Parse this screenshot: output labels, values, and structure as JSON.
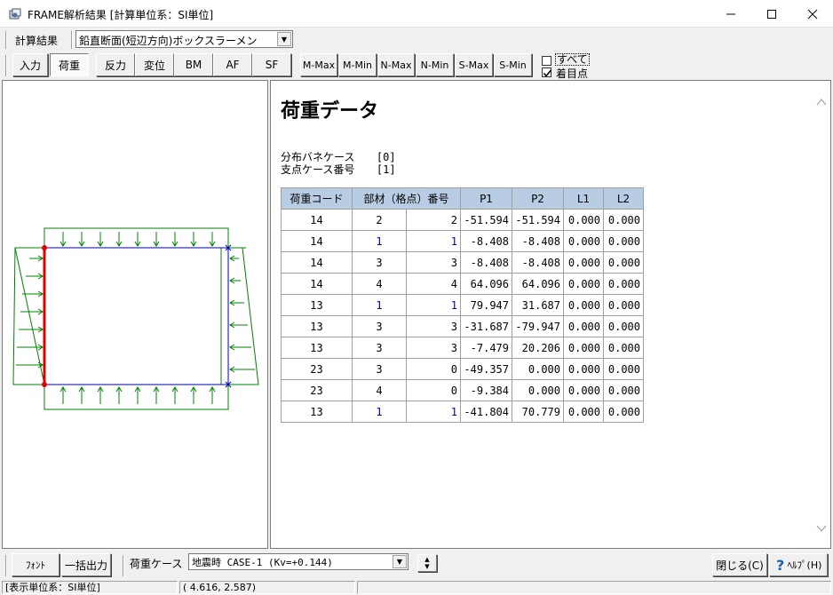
{
  "window": {
    "title": "FRAME解析結果 [計算単位系：SI単位]",
    "minimize": "─",
    "maximize": "☐",
    "close": "✕"
  },
  "toolbar": {
    "calc_label": "計算結果",
    "section_value": "鉛直断面(短辺方向)ボックスラーメン"
  },
  "view_buttons": [
    {
      "label": "入力",
      "active": false
    },
    {
      "label": "荷重",
      "active": true
    },
    {
      "label": "反力",
      "active": false
    },
    {
      "label": "変位",
      "active": false
    },
    {
      "label": "BM",
      "active": false
    },
    {
      "label": "AF",
      "active": false
    },
    {
      "label": "SF",
      "active": false
    },
    {
      "label": "M-Max",
      "active": false
    },
    {
      "label": "M-Min",
      "active": false
    },
    {
      "label": "N-Max",
      "active": false
    },
    {
      "label": "N-Min",
      "active": false
    },
    {
      "label": "S-Max",
      "active": false
    },
    {
      "label": "S-Min",
      "active": false
    }
  ],
  "checkboxes": {
    "all_label": "すべて",
    "all_checked": false,
    "focus_label": "着目点",
    "focus_checked": true
  },
  "report": {
    "title": "荷重データ",
    "spring_case_label": "分布バネケース",
    "spring_case_value": "[0]",
    "support_case_label": "支点ケース番号",
    "support_case_value": "[1]",
    "headers": [
      "荷重コード",
      "部材（格点）番号",
      "P1",
      "P2",
      "L1",
      "L2"
    ],
    "rows": [
      [
        "14",
        "2",
        "2",
        "-51.594",
        "-51.594",
        "0.000",
        "0.000"
      ],
      [
        "14",
        "1",
        "1",
        "-8.408",
        "-8.408",
        "0.000",
        "0.000"
      ],
      [
        "14",
        "3",
        "3",
        "-8.408",
        "-8.408",
        "0.000",
        "0.000"
      ],
      [
        "14",
        "4",
        "4",
        "64.096",
        "64.096",
        "0.000",
        "0.000"
      ],
      [
        "13",
        "1",
        "1",
        "79.947",
        "31.687",
        "0.000",
        "0.000"
      ],
      [
        "13",
        "3",
        "3",
        "-31.687",
        "-79.947",
        "0.000",
        "0.000"
      ],
      [
        "13",
        "3",
        "3",
        "-7.479",
        "20.206",
        "0.000",
        "0.000"
      ],
      [
        "23",
        "3",
        "0",
        "-49.357",
        "0.000",
        "0.000",
        "0.000"
      ],
      [
        "23",
        "4",
        "0",
        "-9.384",
        "0.000",
        "0.000",
        "0.000"
      ],
      [
        "13",
        "1",
        "1",
        "-41.804",
        "70.779",
        "0.000",
        "0.000"
      ]
    ],
    "blue_rows": [
      1,
      4,
      9
    ]
  },
  "bottom": {
    "font_button": "ﾌｫﾝﾄ",
    "export_button": "一括出力",
    "load_case_label": "荷重ケース",
    "load_case_value": "地震時 CASE-1 (Kv=+0.144)",
    "close_button": "閉じる(C)",
    "help_button": "ﾍﾙﾌﾟ(H)"
  },
  "status": {
    "unit": "[表示単位系：SI単位]",
    "coords": "(  4.616,   2.587)"
  },
  "colors": {
    "highlight_member": "#e00000",
    "frame": "#0000b0",
    "load": "#008000",
    "header_bg": "#b8cce4"
  }
}
